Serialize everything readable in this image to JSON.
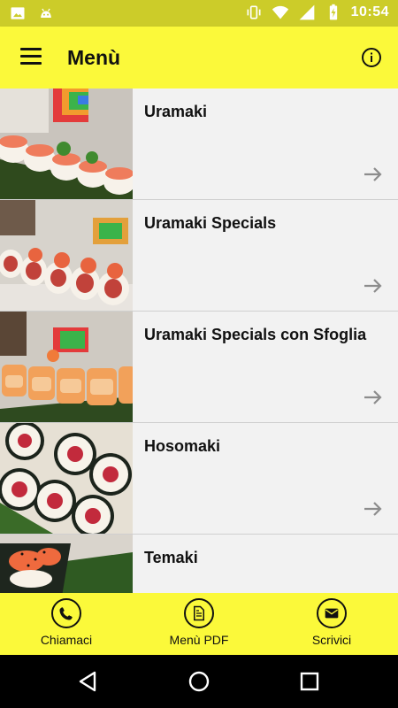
{
  "status_bar": {
    "time": "10:54",
    "left_icons": [
      "image-icon",
      "android-icon"
    ],
    "right_icons": [
      "vibrate-icon",
      "wifi-icon",
      "signal-icon",
      "battery-charging-icon"
    ]
  },
  "app_bar": {
    "title": "Menù",
    "menu_icon": "hamburger-icon",
    "info_icon": "info-icon"
  },
  "menu_items": [
    {
      "label": "Uramaki",
      "image": "uramaki-photo"
    },
    {
      "label": "Uramaki Specials",
      "image": "uramaki-specials-photo"
    },
    {
      "label": "Uramaki Specials con Sfoglia",
      "image": "uramaki-sfoglia-photo"
    },
    {
      "label": "Hosomaki",
      "image": "hosomaki-photo"
    },
    {
      "label": "Temaki",
      "image": "temaki-photo"
    }
  ],
  "bottom_actions": [
    {
      "label": "Chiamaci",
      "icon": "phone-icon"
    },
    {
      "label": "Menù PDF",
      "icon": "document-icon"
    },
    {
      "label": "Scrivici",
      "icon": "mail-icon"
    }
  ],
  "colors": {
    "accent": "#fbf93a",
    "status_bar": "#cccc29",
    "list_background": "#f2f2f2",
    "arrow": "#8c8c8c"
  }
}
